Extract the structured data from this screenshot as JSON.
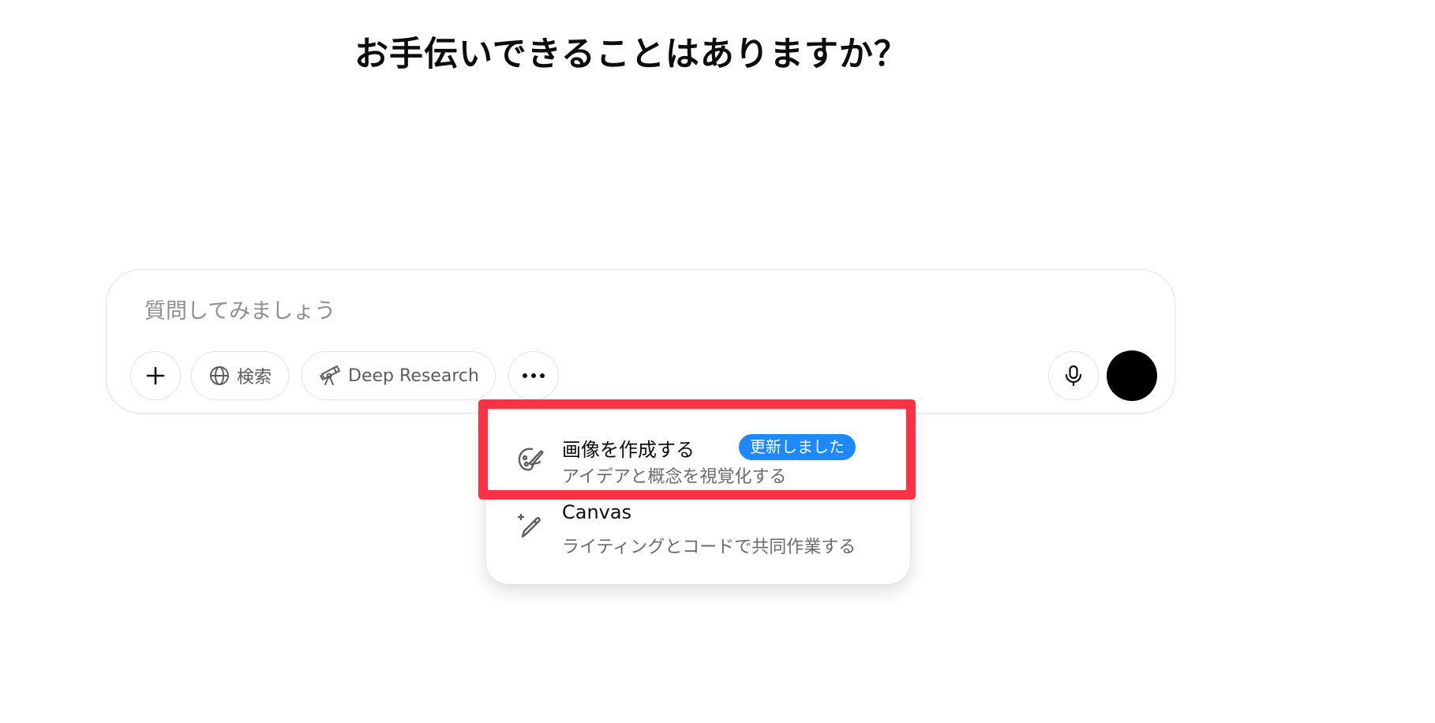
{
  "heading": "お手伝いできることはありますか？",
  "composer": {
    "placeholder": "質問してみましょう",
    "buttons": {
      "add_label": "+",
      "search_label": "検索",
      "deep_research_label": "Deep Research",
      "more_label": "•••"
    }
  },
  "tools_menu": {
    "items": [
      {
        "title": "画像を作成する",
        "badge": "更新しました",
        "subtitle": "アイデアと概念を視覚化する",
        "icon": "palette-icon"
      },
      {
        "title": "Canvas",
        "subtitle": "ライティングとコードで共同作業する",
        "icon": "pencil-sparkle-icon"
      }
    ]
  },
  "colors": {
    "highlight": "#f93345",
    "badge": "#1e88ff",
    "send_button": "#000000"
  }
}
